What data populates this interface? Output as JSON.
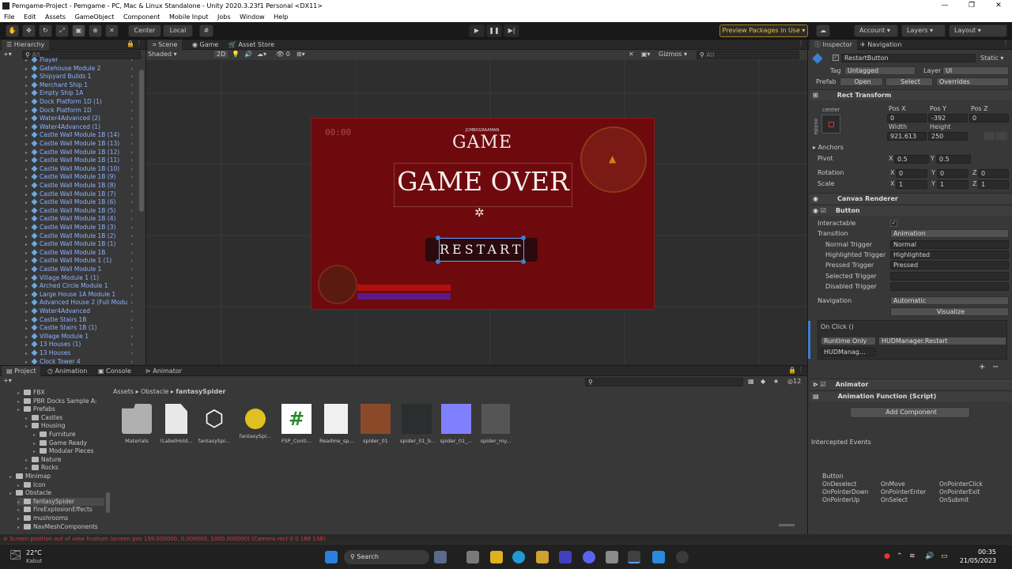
{
  "window": {
    "title": "Pemgame-Project - Pemgame - PC, Mac & Linux Standalone - Unity 2020.3.23f1 Personal <DX11>",
    "minimize": "—",
    "maximize": "❐",
    "close": "✕"
  },
  "menu": [
    "File",
    "Edit",
    "Assets",
    "GameObject",
    "Component",
    "Mobile Input",
    "Jobs",
    "Window",
    "Help"
  ],
  "toolbar": {
    "pivot": "Center",
    "space": "Local",
    "preview_packages": "Preview Packages in Use",
    "account": "Account",
    "layers": "Layers",
    "layout": "Layout"
  },
  "hierarchy": {
    "tab": "Hierarchy",
    "search_placeholder": "All",
    "items": [
      "Player",
      "Gatehouse Module 2",
      "Shipyard Builds 1",
      "Merchant Ship 1",
      "Empty Ship 1A",
      "Dock Platform 1D (1)",
      "Dock Platform 1D",
      "Water4Advanced (2)",
      "Water4Advanced (1)",
      "Castle Wall Module 1B (14)",
      "Castle Wall Module 1B (13)",
      "Castle Wall Module 1B (12)",
      "Castle Wall Module 1B (11)",
      "Castle Wall Module 1B (10)",
      "Castle Wall Module 1B (9)",
      "Castle Wall Module 1B (8)",
      "Castle Wall Module 1B (7)",
      "Castle Wall Module 1B (6)",
      "Castle Wall Module 1B (5)",
      "Castle Wall Module 1B (4)",
      "Castle Wall Module 1B (3)",
      "Castle Wall Module 1B (2)",
      "Castle Wall Module 1B (1)",
      "Castle Wall Module 1B",
      "Castle Wall Module 1 (1)",
      "Castle Wall Module 1",
      "Village Module 1 (1)",
      "Arched Circle Module 1",
      "Large House 1A Module 1",
      "Advanced House 2 (Full Modu",
      "Water4Advanced",
      "Castle Stairs 1B",
      "Castle Stairs 1B (1)",
      "Village Module 1",
      "13 Houses (1)",
      "13 Houses",
      "Clock Tower 4"
    ]
  },
  "scene": {
    "tabs": [
      "Scene",
      "Game",
      "Asset Store"
    ],
    "shading": "Shaded",
    "mode_2d": "2D",
    "gizmos": "Gizmos",
    "search_placeholder": "All",
    "hidden_count": "0",
    "game_ui": {
      "timer": "00:00",
      "small_label": "JCMBOGRAAMAN",
      "title": "GAME",
      "heading": "GAME OVER",
      "button": "RESTART"
    }
  },
  "inspector": {
    "tabs": [
      "Inspector",
      "Navigation"
    ],
    "object_name": "RestartButton",
    "static": "Static",
    "tag_label": "Tag",
    "tag_value": "Untagged",
    "layer_label": "Layer",
    "layer_value": "UI",
    "prefab_label": "Prefab",
    "prefab_open": "Open",
    "prefab_select": "Select",
    "prefab_overrides": "Overrides",
    "rect_transform": {
      "title": "Rect Transform",
      "anchor_h": "center",
      "anchor_v": "middle",
      "pos_x_label": "Pos X",
      "pos_y_label": "Pos Y",
      "pos_z_label": "Pos Z",
      "pos_x": "0",
      "pos_y": "-392",
      "pos_z": "0",
      "width_label": "Width",
      "height_label": "Height",
      "width": "921.613",
      "height": "250",
      "anchors": "Anchors",
      "pivot": "Pivot",
      "pivot_x": "0.5",
      "pivot_y": "0.5",
      "rotation": "Rotation",
      "rot_x": "0",
      "rot_y": "0",
      "rot_z": "0",
      "scale": "Scale",
      "scale_x": "1",
      "scale_y": "1",
      "scale_z": "1",
      "x": "X",
      "y": "Y",
      "z": "Z"
    },
    "canvas_renderer": "Canvas Renderer",
    "button": {
      "title": "Button",
      "interactable": "Interactable",
      "transition": "Transition",
      "transition_value": "Animation",
      "normal_trigger": "Normal Trigger",
      "normal_value": "Normal",
      "highlighted_trigger": "Highlighted Trigger",
      "highlighted_value": "Highlighted",
      "pressed_trigger": "Pressed Trigger",
      "pressed_value": "Pressed",
      "selected_trigger": "Selected Trigger",
      "disabled_trigger": "Disabled Trigger",
      "navigation": "Navigation",
      "navigation_value": "Automatic",
      "visualize": "Visualize",
      "on_click": "On Click ()",
      "runtime": "Runtime Only",
      "function": "HUDManager.Restart",
      "object": "HUDManag…"
    },
    "animator": "Animator",
    "animation_function": "Animation Function (Script)",
    "add_component": "Add Component",
    "intercepted_events": "Intercepted Events",
    "events_header": "Button",
    "events": [
      "OnDeselect",
      "OnMove",
      "OnPointerClick",
      "OnPointerDown",
      "OnPointerEnter",
      "OnPointerExit",
      "OnPointerUp",
      "OnSelect",
      "OnSubmit"
    ]
  },
  "project": {
    "tabs": [
      "Project",
      "Animation",
      "Console",
      "Animator"
    ],
    "breadcrumb": [
      "Assets",
      "Obstacle",
      "fantasySpider"
    ],
    "hidden_count": "12",
    "tree": [
      {
        "label": "FBX",
        "indent": 1
      },
      {
        "label": "PBR Docks Sample A:",
        "indent": 1
      },
      {
        "label": "Prefabs",
        "indent": 1
      },
      {
        "label": "Castles",
        "indent": 2
      },
      {
        "label": "Housing",
        "indent": 2
      },
      {
        "label": "Furniture",
        "indent": 3
      },
      {
        "label": "Game Ready",
        "indent": 3
      },
      {
        "label": "Modular Pieces",
        "indent": 3
      },
      {
        "label": "Nature",
        "indent": 2
      },
      {
        "label": "Rocks",
        "indent": 2
      },
      {
        "label": "Minimap",
        "indent": 0
      },
      {
        "label": "Icon",
        "indent": 1
      },
      {
        "label": "Obstacle",
        "indent": 0
      },
      {
        "label": "fantasySpider",
        "indent": 1
      },
      {
        "label": "FireExplosionEffects",
        "indent": 1
      },
      {
        "label": "mushrooms",
        "indent": 1
      },
      {
        "label": "NavMeshComponents",
        "indent": 1
      }
    ],
    "assets": [
      "Materials",
      "!LabelHold...",
      "fantasySpi...",
      "fantasySpi...",
      "FSP_Conti...",
      "Readme_sp...",
      "spider_01",
      "spider_01_b...",
      "spider_01_...",
      "spider_my..."
    ]
  },
  "status": {
    "error": "Screen position out of view frustum (screen pos 139.000000, 0.000000, 1000.000000) (Camera rect 0 0 188 138)"
  },
  "taskbar": {
    "weather_temp": "22°C",
    "weather_desc": "Kabut",
    "search": "Search",
    "time": "00:35",
    "date": "21/05/2023"
  },
  "colors": {
    "accent_blue": "#3c7fd4",
    "game_overlay": "#6e0a0e",
    "error_red": "#d23b3b"
  }
}
